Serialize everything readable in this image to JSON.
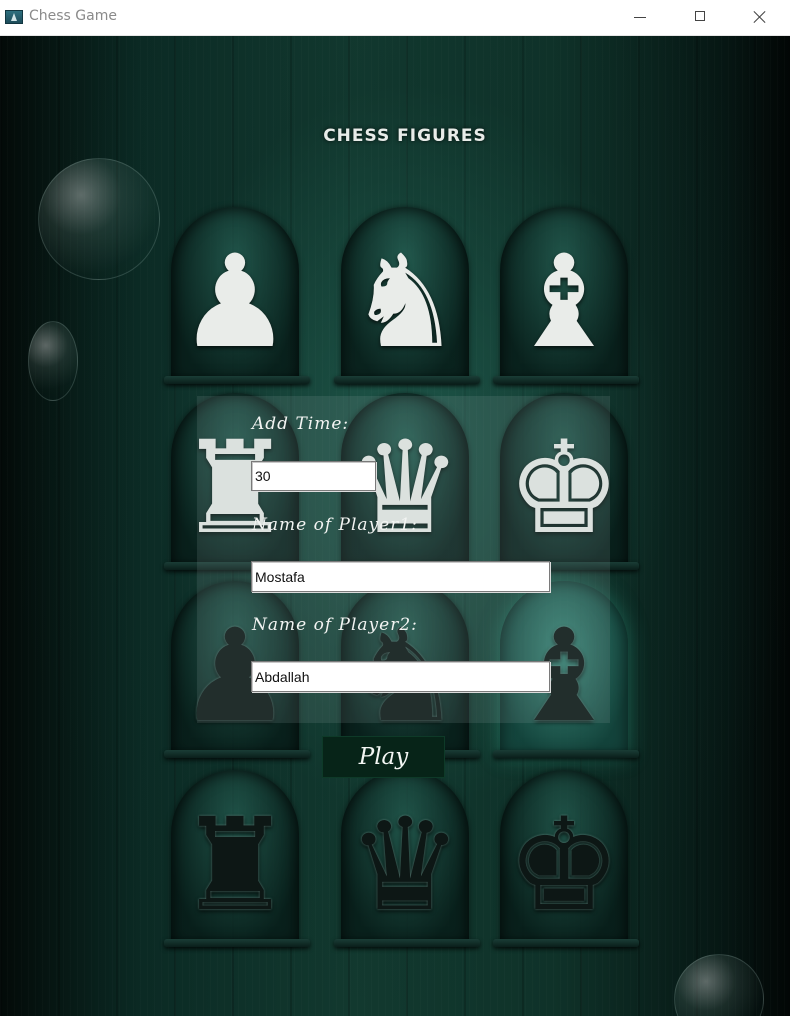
{
  "window": {
    "title": "Chess Game",
    "icon": "app-icon",
    "controls": {
      "minimize_icon": "minimize-icon",
      "maximize_icon": "maximize-icon",
      "close_icon": "close-icon"
    }
  },
  "main": {
    "heading": "CHESS FIGURES",
    "pieces": {
      "row1": [
        "♟",
        "♞",
        "♝"
      ],
      "row2": [
        "♜",
        "♛",
        "♚"
      ],
      "row3": [
        "♟",
        "♞",
        "♝"
      ],
      "row4": [
        "♜",
        "♛",
        "♚"
      ]
    }
  },
  "form": {
    "time_label": "Add Time:",
    "time_value": "30",
    "player1_label": "Name of Player1:",
    "player1_value": "Mostafa",
    "player2_label": "Name of Player2:",
    "player2_value": "Abdallah",
    "play_label": "Play"
  },
  "colors": {
    "background": "#12392f",
    "play_button": "#072418",
    "text": "#f2f4f2"
  }
}
